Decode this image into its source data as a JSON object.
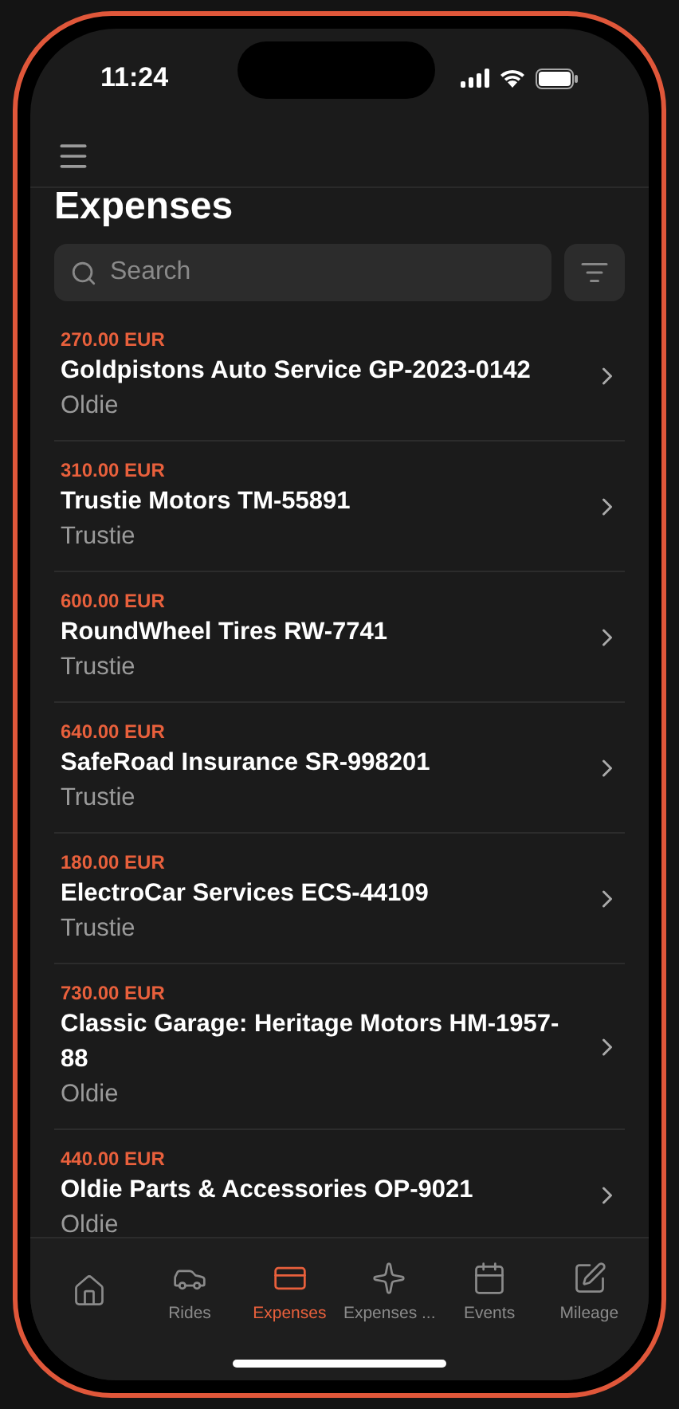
{
  "status_bar": {
    "time": "11:24"
  },
  "title": "Expenses",
  "search": {
    "placeholder": "Search"
  },
  "expenses": [
    {
      "amount": "270.00 EUR",
      "name": "Goldpistons Auto Service GP-2023-0142",
      "owner": "Oldie"
    },
    {
      "amount": "310.00 EUR",
      "name": "Trustie Motors TM-55891",
      "owner": "Trustie"
    },
    {
      "amount": "600.00 EUR",
      "name": "RoundWheel Tires RW-7741",
      "owner": "Trustie"
    },
    {
      "amount": "640.00 EUR",
      "name": "SafeRoad Insurance SR-998201",
      "owner": "Trustie"
    },
    {
      "amount": "180.00 EUR",
      "name": "ElectroCar Services ECS-44109",
      "owner": "Trustie"
    },
    {
      "amount": "730.00 EUR",
      "name": "Classic Garage: Heritage Motors HM-1957-88",
      "owner": "Oldie"
    },
    {
      "amount": "440.00 EUR",
      "name": "Oldie Parts & Accessories OP-9021",
      "owner": "Oldie"
    }
  ],
  "tabs": [
    {
      "selected": false
    },
    {
      "label": "Rides",
      "selected": false
    },
    {
      "label": "Expenses",
      "selected": true
    },
    {
      "label": "Expenses ...",
      "selected": false
    },
    {
      "label": "Events",
      "selected": false
    },
    {
      "label": "Mileage",
      "selected": false
    }
  ]
}
